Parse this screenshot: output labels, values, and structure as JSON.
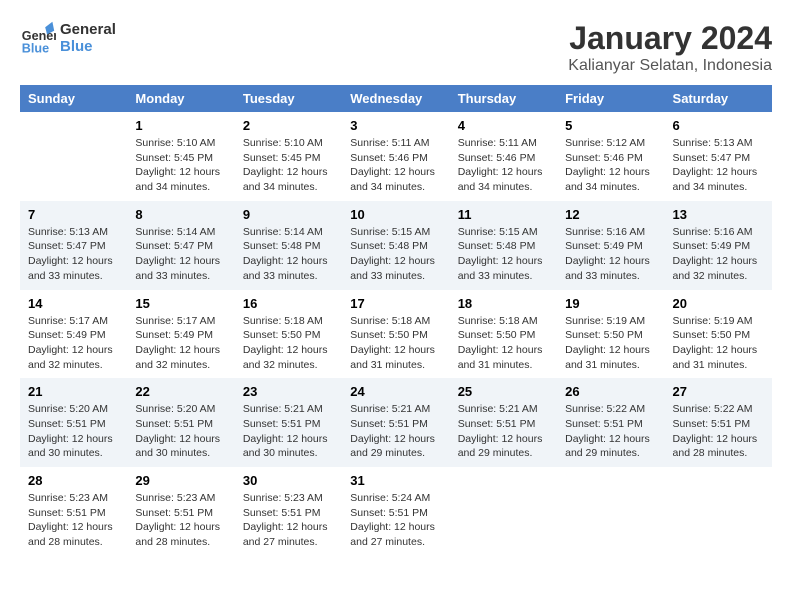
{
  "logo": {
    "line1": "General",
    "line2": "Blue"
  },
  "title": "January 2024",
  "subtitle": "Kalianyar Selatan, Indonesia",
  "header_days": [
    "Sunday",
    "Monday",
    "Tuesday",
    "Wednesday",
    "Thursday",
    "Friday",
    "Saturday"
  ],
  "weeks": [
    [
      {
        "day": "",
        "info": ""
      },
      {
        "day": "1",
        "info": "Sunrise: 5:10 AM\nSunset: 5:45 PM\nDaylight: 12 hours\nand 34 minutes."
      },
      {
        "day": "2",
        "info": "Sunrise: 5:10 AM\nSunset: 5:45 PM\nDaylight: 12 hours\nand 34 minutes."
      },
      {
        "day": "3",
        "info": "Sunrise: 5:11 AM\nSunset: 5:46 PM\nDaylight: 12 hours\nand 34 minutes."
      },
      {
        "day": "4",
        "info": "Sunrise: 5:11 AM\nSunset: 5:46 PM\nDaylight: 12 hours\nand 34 minutes."
      },
      {
        "day": "5",
        "info": "Sunrise: 5:12 AM\nSunset: 5:46 PM\nDaylight: 12 hours\nand 34 minutes."
      },
      {
        "day": "6",
        "info": "Sunrise: 5:13 AM\nSunset: 5:47 PM\nDaylight: 12 hours\nand 34 minutes."
      }
    ],
    [
      {
        "day": "7",
        "info": "Sunrise: 5:13 AM\nSunset: 5:47 PM\nDaylight: 12 hours\nand 33 minutes."
      },
      {
        "day": "8",
        "info": "Sunrise: 5:14 AM\nSunset: 5:47 PM\nDaylight: 12 hours\nand 33 minutes."
      },
      {
        "day": "9",
        "info": "Sunrise: 5:14 AM\nSunset: 5:48 PM\nDaylight: 12 hours\nand 33 minutes."
      },
      {
        "day": "10",
        "info": "Sunrise: 5:15 AM\nSunset: 5:48 PM\nDaylight: 12 hours\nand 33 minutes."
      },
      {
        "day": "11",
        "info": "Sunrise: 5:15 AM\nSunset: 5:48 PM\nDaylight: 12 hours\nand 33 minutes."
      },
      {
        "day": "12",
        "info": "Sunrise: 5:16 AM\nSunset: 5:49 PM\nDaylight: 12 hours\nand 33 minutes."
      },
      {
        "day": "13",
        "info": "Sunrise: 5:16 AM\nSunset: 5:49 PM\nDaylight: 12 hours\nand 32 minutes."
      }
    ],
    [
      {
        "day": "14",
        "info": "Sunrise: 5:17 AM\nSunset: 5:49 PM\nDaylight: 12 hours\nand 32 minutes."
      },
      {
        "day": "15",
        "info": "Sunrise: 5:17 AM\nSunset: 5:49 PM\nDaylight: 12 hours\nand 32 minutes."
      },
      {
        "day": "16",
        "info": "Sunrise: 5:18 AM\nSunset: 5:50 PM\nDaylight: 12 hours\nand 32 minutes."
      },
      {
        "day": "17",
        "info": "Sunrise: 5:18 AM\nSunset: 5:50 PM\nDaylight: 12 hours\nand 31 minutes."
      },
      {
        "day": "18",
        "info": "Sunrise: 5:18 AM\nSunset: 5:50 PM\nDaylight: 12 hours\nand 31 minutes."
      },
      {
        "day": "19",
        "info": "Sunrise: 5:19 AM\nSunset: 5:50 PM\nDaylight: 12 hours\nand 31 minutes."
      },
      {
        "day": "20",
        "info": "Sunrise: 5:19 AM\nSunset: 5:50 PM\nDaylight: 12 hours\nand 31 minutes."
      }
    ],
    [
      {
        "day": "21",
        "info": "Sunrise: 5:20 AM\nSunset: 5:51 PM\nDaylight: 12 hours\nand 30 minutes."
      },
      {
        "day": "22",
        "info": "Sunrise: 5:20 AM\nSunset: 5:51 PM\nDaylight: 12 hours\nand 30 minutes."
      },
      {
        "day": "23",
        "info": "Sunrise: 5:21 AM\nSunset: 5:51 PM\nDaylight: 12 hours\nand 30 minutes."
      },
      {
        "day": "24",
        "info": "Sunrise: 5:21 AM\nSunset: 5:51 PM\nDaylight: 12 hours\nand 29 minutes."
      },
      {
        "day": "25",
        "info": "Sunrise: 5:21 AM\nSunset: 5:51 PM\nDaylight: 12 hours\nand 29 minutes."
      },
      {
        "day": "26",
        "info": "Sunrise: 5:22 AM\nSunset: 5:51 PM\nDaylight: 12 hours\nand 29 minutes."
      },
      {
        "day": "27",
        "info": "Sunrise: 5:22 AM\nSunset: 5:51 PM\nDaylight: 12 hours\nand 28 minutes."
      }
    ],
    [
      {
        "day": "28",
        "info": "Sunrise: 5:23 AM\nSunset: 5:51 PM\nDaylight: 12 hours\nand 28 minutes."
      },
      {
        "day": "29",
        "info": "Sunrise: 5:23 AM\nSunset: 5:51 PM\nDaylight: 12 hours\nand 28 minutes."
      },
      {
        "day": "30",
        "info": "Sunrise: 5:23 AM\nSunset: 5:51 PM\nDaylight: 12 hours\nand 27 minutes."
      },
      {
        "day": "31",
        "info": "Sunrise: 5:24 AM\nSunset: 5:51 PM\nDaylight: 12 hours\nand 27 minutes."
      },
      {
        "day": "",
        "info": ""
      },
      {
        "day": "",
        "info": ""
      },
      {
        "day": "",
        "info": ""
      }
    ]
  ]
}
